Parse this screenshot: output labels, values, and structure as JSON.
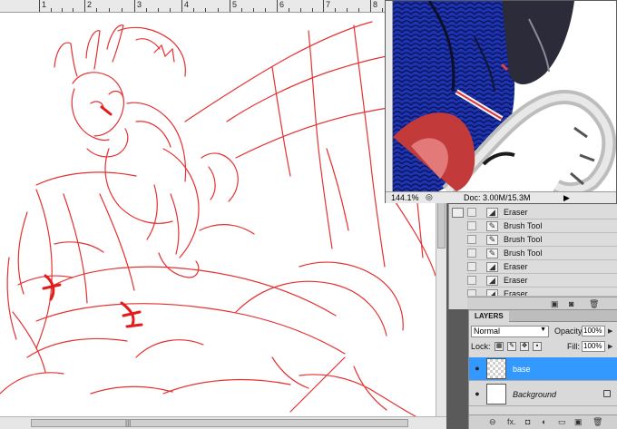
{
  "ruler": {
    "labels": [
      "1",
      "2",
      "3",
      "4",
      "5",
      "6",
      "7",
      "8"
    ]
  },
  "doc_window": {
    "zoom": "144.1%",
    "doc_info": "Doc: 3.00M/15.3M",
    "nav_arrow": "▶"
  },
  "history": {
    "items": [
      {
        "label": "Eraser",
        "icon": "eraser-icon"
      },
      {
        "label": "Brush Tool",
        "icon": "brush-icon"
      },
      {
        "label": "Brush Tool",
        "icon": "brush-icon"
      },
      {
        "label": "Brush Tool",
        "icon": "brush-icon"
      },
      {
        "label": "Eraser",
        "icon": "eraser-icon"
      },
      {
        "label": "Eraser",
        "icon": "eraser-icon"
      },
      {
        "label": "Eraser",
        "icon": "eraser-icon"
      }
    ]
  },
  "layers": {
    "tab_label": "LAYERS",
    "blend_mode": "Normal",
    "opacity_label": "Opacity:",
    "opacity_value": "100%",
    "lock_label": "Lock:",
    "fill_label": "Fill:",
    "fill_value": "100%",
    "items": [
      {
        "name": "base",
        "selected": true
      },
      {
        "name": "Background",
        "selected": false
      }
    ],
    "footer_fx": "fx."
  },
  "colors": {
    "sketch_red": "#e21b1b",
    "selection_blue": "#3399ff",
    "dragon_blue": "#1e34b0"
  }
}
